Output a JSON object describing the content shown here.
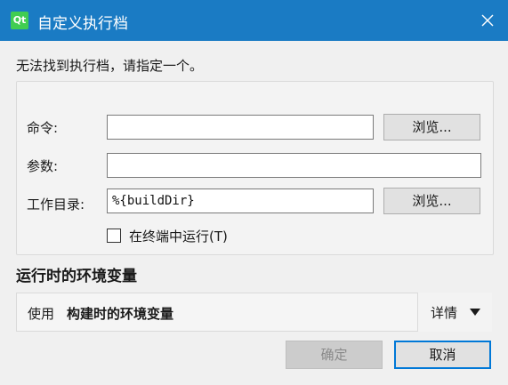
{
  "window": {
    "title": "自定义执行档",
    "app_icon_text": "Qt"
  },
  "prompt": "无法找到执行档，请指定一个。",
  "form": {
    "command_label": "命令:",
    "command_value": "",
    "command_browse": "浏览...",
    "args_label": "参数:",
    "args_value": "",
    "workdir_label": "工作目录:",
    "workdir_value": "%{buildDir}",
    "workdir_browse": "浏览...",
    "run_in_terminal_label": "在终端中运行(T)",
    "run_in_terminal_checked": false
  },
  "environment": {
    "section_title": "运行时的环境变量",
    "prefix": "使用",
    "value": "构建时的环境变量",
    "details_label": "详情"
  },
  "buttons": {
    "ok": "确定",
    "cancel": "取消"
  },
  "colors": {
    "titlebar": "#1a7bc4",
    "focus_border": "#0078d7",
    "qt_green": "#41cd52"
  }
}
